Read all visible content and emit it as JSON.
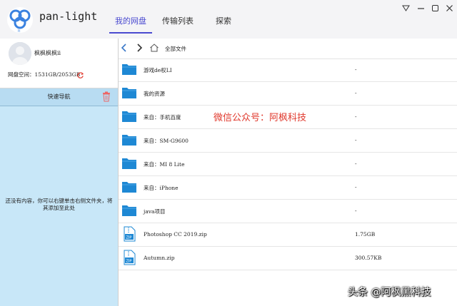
{
  "app": {
    "title": "pan-light"
  },
  "tabs": [
    {
      "label": "我的网盘",
      "active": true
    },
    {
      "label": "传输列表",
      "active": false
    },
    {
      "label": "探索",
      "active": false
    }
  ],
  "window_controls": [
    "minimize-dropdown",
    "minimize",
    "maximize",
    "close"
  ],
  "user": {
    "name": "枫枫枫枫ii",
    "quota_label": "网盘空间：1531GB/2053GB"
  },
  "quick_nav": {
    "label": "快速导航",
    "empty_text": "还没有内容，你可以右键单击右侧文件夹，将其添加至此处"
  },
  "toolbar": {
    "breadcrumb": "全部文件"
  },
  "files": [
    {
      "name": "游戏de权LI",
      "size": "-",
      "type": "folder"
    },
    {
      "name": "我的资源",
      "size": "-",
      "type": "folder"
    },
    {
      "name": "来自：手机百度",
      "size": "-",
      "type": "folder"
    },
    {
      "name": "来自：SM-G9600",
      "size": "-",
      "type": "folder"
    },
    {
      "name": "来自：MI 8 Lite",
      "size": "-",
      "type": "folder"
    },
    {
      "name": "来自：iPhone",
      "size": "-",
      "type": "folder"
    },
    {
      "name": "java项目",
      "size": "-",
      "type": "folder"
    },
    {
      "name": "Photoshop CC 2019.zip",
      "size": "1.75GB",
      "type": "zip"
    },
    {
      "name": "Autumn.zip",
      "size": "300.57KB",
      "type": "zip"
    }
  ],
  "overlay": {
    "center_watermark": "微信公众号：阿枫科技",
    "corner_watermark": "头条 @阿枫黑科技"
  },
  "colors": {
    "accent": "#4a4ad0",
    "folder": "#1e88d4",
    "nav_panel": "#c8e7f8",
    "watermark_red": "#e0392d"
  }
}
